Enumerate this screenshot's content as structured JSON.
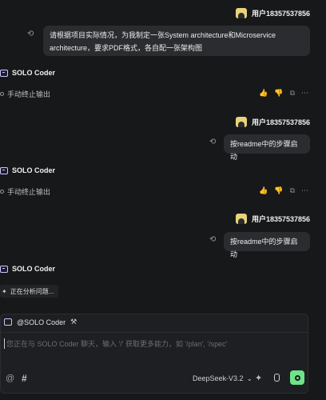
{
  "messages": {
    "user1": {
      "name": "用户18357537856",
      "text_line1": "请根据项目实际情况，为我制定一张System architecture和Microservice",
      "text_line2": "architecture，要求PDF格式，各自配一张架构图"
    },
    "bot1": {
      "name": "SOLO Coder",
      "status": "手动终止输出"
    },
    "user2": {
      "name": "用户18357537856",
      "text": "按readme中的步骤启动"
    },
    "bot2": {
      "name": "SOLO Coder",
      "status": "手动终止输出"
    },
    "user3": {
      "name": "用户18357537856",
      "text": "按readme中的步骤启动"
    },
    "bot3": {
      "name": "SOLO Coder",
      "status": "正在分析问题..."
    }
  },
  "composer": {
    "chip_label": "@SOLO Coder",
    "placeholder": "您正在与 SOLO Coder 聊天，输入 '/' 获取更多能力，如 '/plan', '/spec'",
    "model": "DeepSeek-V3.2"
  }
}
